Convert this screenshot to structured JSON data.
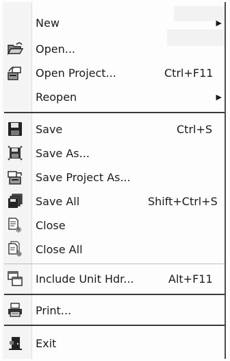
{
  "menu": {
    "items": [
      {
        "label": "New",
        "shortcut": "",
        "submenu": true,
        "icon": "none"
      },
      {
        "label": "Open...",
        "shortcut": "",
        "submenu": false,
        "icon": "open-folder-icon"
      },
      {
        "label": "Open Project...",
        "shortcut": "Ctrl+F11",
        "submenu": false,
        "icon": "open-project-icon"
      },
      {
        "label": "Reopen",
        "shortcut": "",
        "submenu": true,
        "icon": "none"
      },
      {
        "label": "Save",
        "shortcut": "Ctrl+S",
        "submenu": false,
        "icon": "floppy-disk-icon"
      },
      {
        "label": "Save As...",
        "shortcut": "",
        "submenu": false,
        "icon": "save-as-icon"
      },
      {
        "label": "Save Project As...",
        "shortcut": "",
        "submenu": false,
        "icon": "save-project-as-icon"
      },
      {
        "label": "Save All",
        "shortcut": "Shift+Ctrl+S",
        "submenu": false,
        "icon": "save-all-icon"
      },
      {
        "label": "Close",
        "shortcut": "",
        "submenu": false,
        "icon": "close-file-icon"
      },
      {
        "label": "Close All",
        "shortcut": "",
        "submenu": false,
        "icon": "close-all-icon"
      },
      {
        "label": "Include Unit Hdr...",
        "shortcut": "Alt+F11",
        "submenu": false,
        "icon": "include-unit-icon"
      },
      {
        "label": "Print...",
        "shortcut": "",
        "submenu": false,
        "icon": "printer-icon"
      },
      {
        "label": "Exit",
        "shortcut": "",
        "submenu": false,
        "icon": "exit-door-icon"
      }
    ],
    "submenu_arrow": "▶"
  }
}
